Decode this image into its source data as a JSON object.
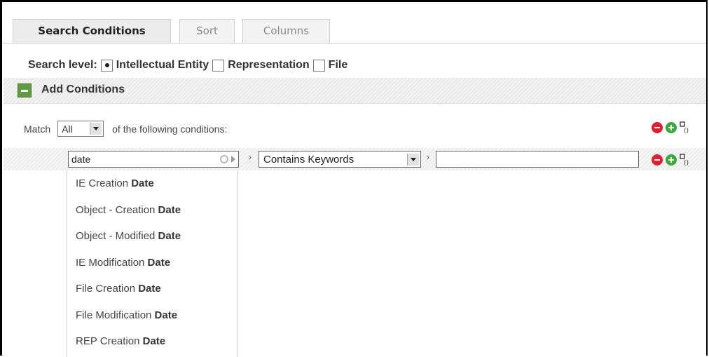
{
  "tabs": [
    {
      "label": "Search Conditions",
      "active": true
    },
    {
      "label": "Sort",
      "active": false
    },
    {
      "label": "Columns",
      "active": false
    }
  ],
  "search_level": {
    "label": "Search level:",
    "options": [
      {
        "label": "Intellectual Entity",
        "checked": true
      },
      {
        "label": "Representation",
        "checked": false
      },
      {
        "label": "File",
        "checked": false
      }
    ]
  },
  "add_conditions": {
    "label": "Add Conditions"
  },
  "match": {
    "prefix": "Match",
    "selected": "All",
    "suffix": "of the following conditions:"
  },
  "condition": {
    "field_value": "date",
    "operator": "Contains Keywords",
    "value": ""
  },
  "suggestions": [
    {
      "prefix": "IE Creation ",
      "match": "Date"
    },
    {
      "prefix": "Object - Creation ",
      "match": "Date"
    },
    {
      "prefix": "Object - Modified ",
      "match": "Date"
    },
    {
      "prefix": "IE Modification ",
      "match": "Date"
    },
    {
      "prefix": "File Creation ",
      "match": "Date"
    },
    {
      "prefix": "File Modification ",
      "match": "Date"
    },
    {
      "prefix": "REP Creation ",
      "match": "Date"
    }
  ],
  "icons": {
    "remove": "remove-circle-icon",
    "add": "add-circle-icon",
    "group": "group-condition-icon"
  },
  "colors": {
    "remove": "#e0202d",
    "add": "#3aa93a",
    "collapse": "#5d9c3f"
  }
}
